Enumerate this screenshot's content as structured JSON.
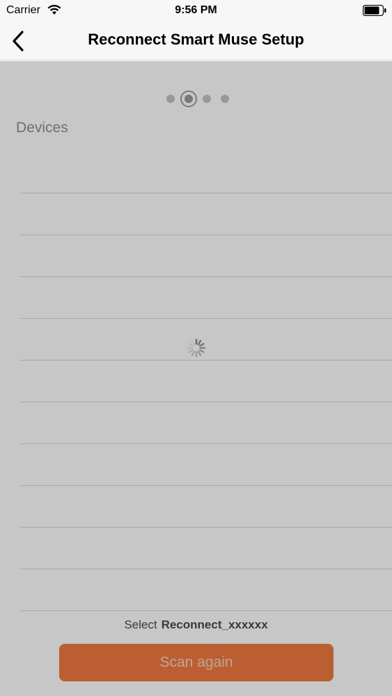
{
  "status_bar": {
    "carrier": "Carrier",
    "time": "9:56 PM",
    "wifi_icon": "wifi-icon",
    "battery_icon": "battery-icon"
  },
  "nav": {
    "title": "Reconnect Smart Muse Setup",
    "back_icon": "chevron-left-icon"
  },
  "pager": {
    "total": 4,
    "current": 2
  },
  "devices": {
    "title": "Devices",
    "rows": 11
  },
  "select": {
    "prefix": "Select",
    "device_name": "Reconnect_xxxxxx"
  },
  "scan_button": {
    "label": "Scan again"
  },
  "loading": {
    "visible": true,
    "spinner_icon": "spinner-icon"
  },
  "colors": {
    "accent": "#f07a41",
    "overlay": "rgba(0,0,0,0.22)"
  }
}
